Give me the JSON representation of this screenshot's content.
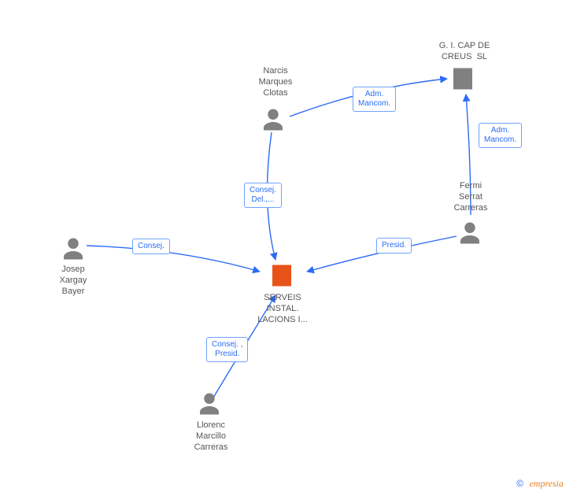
{
  "diagram": {
    "nodes": {
      "center_company": {
        "label": "SERVEIS\nINSTAL.\nLACIONS I..."
      },
      "company2": {
        "label": "G. I. CAP DE\nCREUS  SL"
      },
      "person_nmc": {
        "label": "Narcis\nMarques\nClotas"
      },
      "person_fsc": {
        "label": "Fermi\nSerrat\nCarreras"
      },
      "person_jxb": {
        "label": "Josep\nXargay\nBayer"
      },
      "person_lmc": {
        "label": "Llorenc\nMarcillo\nCarreras"
      }
    },
    "edges": {
      "nmc_to_cap": {
        "label": "Adm.\nMancom."
      },
      "fsc_to_cap": {
        "label": "Adm.\nMancom."
      },
      "nmc_to_center": {
        "label": "Consej.\nDel.,..."
      },
      "fsc_to_center": {
        "label": "Presid."
      },
      "jxb_to_center": {
        "label": "Consej."
      },
      "lmc_to_center": {
        "label": "Consej. ,\nPresid."
      }
    },
    "colors": {
      "person": "#808080",
      "company_gray": "#808080",
      "company_accent": "#e8531a",
      "link": "#2b6cf5"
    }
  },
  "footer": {
    "copyright_symbol": "©",
    "brand": "empresia"
  }
}
